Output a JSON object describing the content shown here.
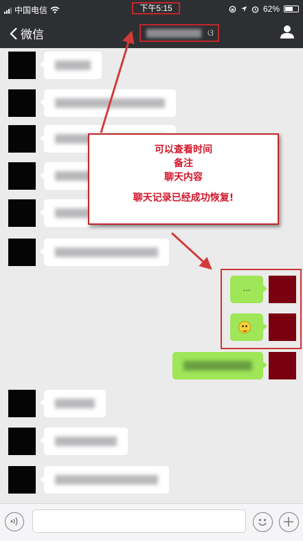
{
  "status_bar": {
    "carrier": "中国电信",
    "time": "下午5:15",
    "battery": "62%",
    "battery_level": 0.62
  },
  "nav": {
    "back_label": "微信"
  },
  "messages": [
    {
      "side": "left",
      "blur_width": 52
    },
    {
      "side": "left",
      "blur_width": 160
    },
    {
      "side": "left",
      "blur_width": 160
    },
    {
      "side": "left",
      "blur_width": 140
    },
    {
      "side": "left",
      "blur_width": 50
    },
    {
      "side": "left",
      "blur_width": 150
    },
    {
      "side": "right",
      "text": "..."
    },
    {
      "side": "right",
      "emoji": "smile-emoji"
    },
    {
      "side": "right",
      "blur_width": 100
    },
    {
      "side": "left",
      "blur_width": 58
    },
    {
      "side": "left",
      "blur_width": 90
    },
    {
      "side": "left",
      "blur_width": 150
    }
  ],
  "annotation": {
    "line1": "可以查看时间",
    "line2": "备注",
    "line3": "聊天内容",
    "line4": "聊天记录已经成功恢复!"
  },
  "colors": {
    "highlight": "#c0282b",
    "annotation_text": "#d1162a",
    "bubble_green": "#9fe658",
    "nav_bg": "#2e2f33"
  },
  "icons": [
    "wifi-icon",
    "back-chevron-icon",
    "user-icon",
    "voice-icon",
    "emoji-icon",
    "plus-icon",
    "location-icon",
    "alarm-icon",
    "lock-rotation-icon"
  ]
}
